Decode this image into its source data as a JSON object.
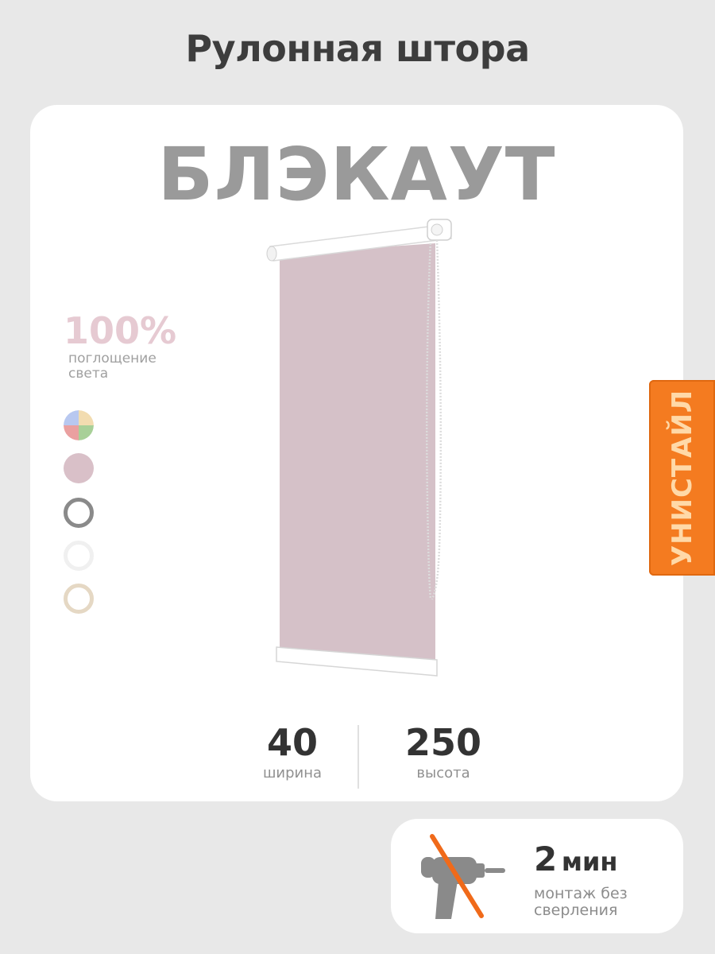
{
  "header": {
    "title": "Рулонная штора"
  },
  "product": {
    "name": "БЛЭКАУТ"
  },
  "light": {
    "percent": "100%",
    "caption": "поглощение света"
  },
  "swatches": [
    {
      "name": "multicolor",
      "colors": [
        "#b8c8f0",
        "#f2dcb0",
        "#eaa0a0",
        "#a8d098"
      ]
    },
    {
      "name": "pink",
      "color": "#d9c0c8"
    },
    {
      "name": "gray",
      "color": "#8a8a8a"
    },
    {
      "name": "white",
      "color": "#f0f0f0"
    },
    {
      "name": "beige",
      "color": "#e5d8c4"
    }
  ],
  "dimensions": {
    "width": {
      "value": "40",
      "label": "ширина"
    },
    "height": {
      "value": "250",
      "label": "высота"
    }
  },
  "brand": {
    "name": "УНИСТАЙЛ",
    "color": "#f47b20"
  },
  "install": {
    "number": "2",
    "unit": "мин",
    "caption": "монтаж без сверления"
  },
  "colors": {
    "blind_fabric": "#d5c1c8",
    "strike": "#f06a1a",
    "drill": "#8a8a8a"
  }
}
